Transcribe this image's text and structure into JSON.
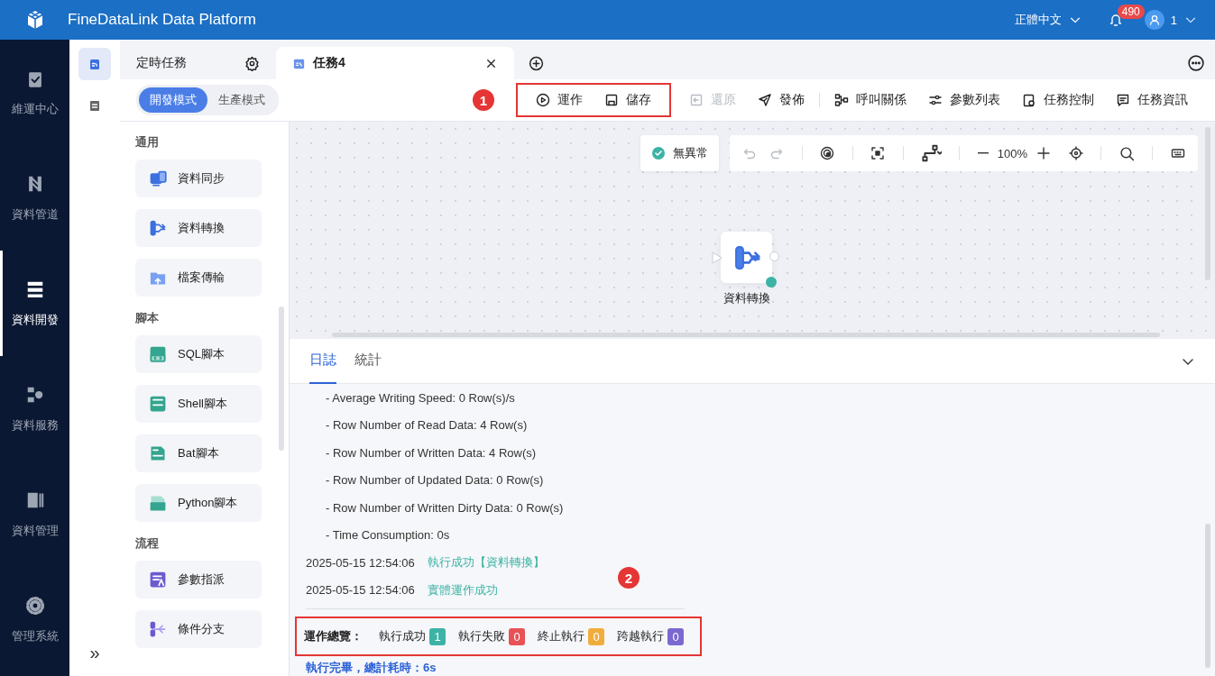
{
  "header": {
    "title": "FineDataLink Data Platform",
    "language": "正體中文",
    "notifications": "490",
    "user": "1"
  },
  "nav": [
    {
      "label": "維運中心",
      "selected": false
    },
    {
      "label": "資料管道",
      "selected": false
    },
    {
      "label": "資料開發",
      "selected": true
    },
    {
      "label": "資料服務",
      "selected": false
    },
    {
      "label": "資料管理",
      "selected": false
    },
    {
      "label": "管理系統",
      "selected": false
    }
  ],
  "subnav": {
    "items": [
      {
        "selected": true
      },
      {
        "selected": false
      }
    ],
    "expand": "»"
  },
  "tabs": [
    {
      "label": "定時任務",
      "kind": "folder",
      "selected": false
    },
    {
      "label": "任務4",
      "kind": "task",
      "selected": true
    }
  ],
  "modes": [
    {
      "label": "開發模式",
      "selected": true
    },
    {
      "label": "生產模式",
      "selected": false
    }
  ],
  "annotations": [
    {
      "number": "1"
    },
    {
      "number": "2"
    }
  ],
  "toolbar": [
    {
      "label": "運作",
      "kind": "run",
      "disabled": false
    },
    {
      "label": "儲存",
      "kind": "save",
      "disabled": false
    },
    {
      "label": "還原",
      "kind": "restore",
      "disabled": true
    },
    {
      "label": "發佈",
      "kind": "publish",
      "disabled": false
    },
    {
      "label": "呼叫關係",
      "kind": "relation",
      "disabled": false
    },
    {
      "label": "參數列表",
      "kind": "params",
      "disabled": false
    },
    {
      "label": "任務控制",
      "kind": "control",
      "disabled": false
    },
    {
      "label": "任務資訊",
      "kind": "info",
      "disabled": false
    }
  ],
  "palette": [
    {
      "title": "通用",
      "items": [
        {
          "label": "資料同步",
          "kind": "sync"
        },
        {
          "label": "資料轉換",
          "kind": "transform"
        },
        {
          "label": "檔案傳輸",
          "kind": "file"
        }
      ]
    },
    {
      "title": "腳本",
      "items": [
        {
          "label": "SQL腳本",
          "kind": "sql"
        },
        {
          "label": "Shell腳本",
          "kind": "shell"
        },
        {
          "label": "Bat腳本",
          "kind": "bat"
        },
        {
          "label": "Python腳本",
          "kind": "python"
        }
      ]
    },
    {
      "title": "流程",
      "items": [
        {
          "label": "參數指派",
          "kind": "param"
        },
        {
          "label": "條件分支",
          "kind": "branch"
        }
      ]
    }
  ],
  "canvas": {
    "status": "無異常",
    "zoom": "100%",
    "node": {
      "label": "資料轉換"
    }
  },
  "log_tabs": [
    {
      "label": "日誌",
      "selected": true
    },
    {
      "label": "統計",
      "selected": false
    }
  ],
  "log": [
    {
      "kind": "detail",
      "text": "- Average Writing Speed: 0 Row(s)/s"
    },
    {
      "kind": "detail",
      "text": "- Row Number of Read Data: 4 Row(s)"
    },
    {
      "kind": "detail",
      "text": "- Row Number of Written Data: 4 Row(s)"
    },
    {
      "kind": "detail",
      "text": "- Row Number of Updated Data: 0 Row(s)"
    },
    {
      "kind": "detail",
      "text": "- Row Number of Written Dirty Data: 0 Row(s)"
    },
    {
      "kind": "detail",
      "text": "- Time Consumption: 0s"
    },
    {
      "kind": "event",
      "time": "2025-05-15 12:54:06",
      "text": "執行成功【資料轉換】"
    },
    {
      "kind": "event",
      "time": "2025-05-15 12:54:06",
      "text": "實體運作成功"
    }
  ],
  "summary": {
    "label": "運作總覽：",
    "stats": [
      {
        "label": "執行成功",
        "count": "1",
        "color": "#3cb3a5"
      },
      {
        "label": "執行失敗",
        "count": "0",
        "color": "#e85155"
      },
      {
        "label": "終止執行",
        "count": "0",
        "color": "#f0ad3c"
      },
      {
        "label": "跨越執行",
        "count": "0",
        "color": "#7b68d1"
      }
    ]
  },
  "result": "執行完畢，總計耗時：6s"
}
